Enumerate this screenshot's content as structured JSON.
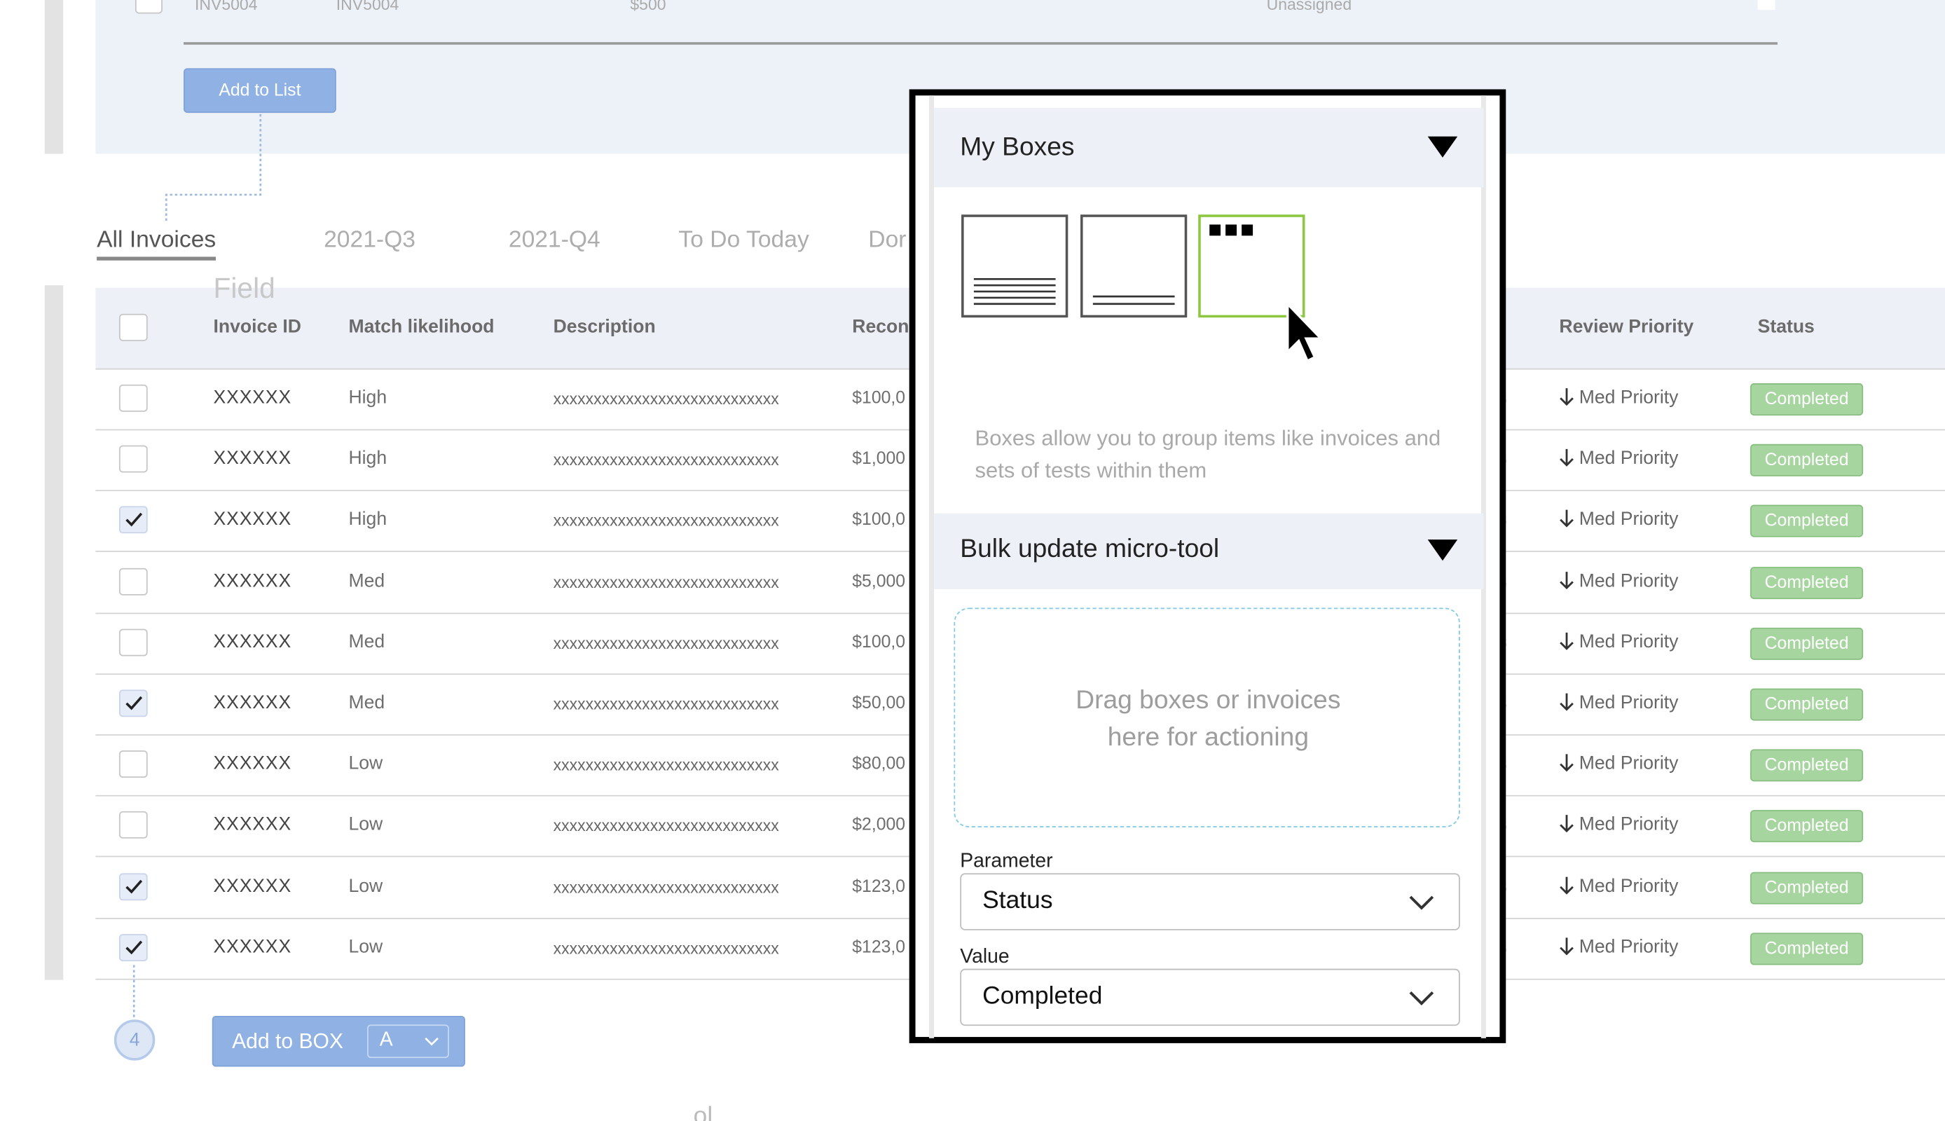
{
  "top_row": {
    "col1": "INV5004",
    "col2": "INV5004",
    "amount": "$500",
    "status": "Unassigned"
  },
  "add_to_list_label": "Add to List",
  "tabs": [
    {
      "label": "All Invoices",
      "active": true
    },
    {
      "label": "2021-Q3"
    },
    {
      "label": "2021-Q4"
    },
    {
      "label": "To Do Today"
    },
    {
      "label": "Dor"
    }
  ],
  "field_label": "Field",
  "columns": [
    "Invoice ID",
    "Match likelihood",
    "Description",
    "Recon",
    "Review Priority",
    "Status"
  ],
  "rows": [
    {
      "checked": false,
      "id": "XXXXXX",
      "match": "High",
      "desc": "xxxxxxxxxxxxxxxxxxxxxxxxxxxx",
      "amount": "$100,0",
      "priority": "Med Priority",
      "status": "Completed"
    },
    {
      "checked": false,
      "id": "XXXXXX",
      "match": "High",
      "desc": "xxxxxxxxxxxxxxxxxxxxxxxxxxxx",
      "amount": "$1,000",
      "priority": "Med Priority",
      "status": "Completed"
    },
    {
      "checked": true,
      "id": "XXXXXX",
      "match": "High",
      "desc": "xxxxxxxxxxxxxxxxxxxxxxxxxxxx",
      "amount": "$100,0",
      "priority": "Med Priority",
      "status": "Completed"
    },
    {
      "checked": false,
      "id": "XXXXXX",
      "match": "Med",
      "desc": "xxxxxxxxxxxxxxxxxxxxxxxxxxxx",
      "amount": "$5,000",
      "priority": "Med Priority",
      "status": "Completed"
    },
    {
      "checked": false,
      "id": "XXXXXX",
      "match": "Med",
      "desc": "xxxxxxxxxxxxxxxxxxxxxxxxxxxx",
      "amount": "$100,0",
      "priority": "Med Priority",
      "status": "Completed"
    },
    {
      "checked": true,
      "id": "XXXXXX",
      "match": "Med",
      "desc": "xxxxxxxxxxxxxxxxxxxxxxxxxxxx",
      "amount": "$50,00",
      "priority": "Med Priority",
      "status": "Completed"
    },
    {
      "checked": false,
      "id": "XXXXXX",
      "match": "Low",
      "desc": "xxxxxxxxxxxxxxxxxxxxxxxxxxxx",
      "amount": "$80,00",
      "priority": "Med Priority",
      "status": "Completed"
    },
    {
      "checked": false,
      "id": "XXXXXX",
      "match": "Low",
      "desc": "xxxxxxxxxxxxxxxxxxxxxxxxxxxx",
      "amount": "$2,000",
      "priority": "Med Priority",
      "status": "Completed"
    },
    {
      "checked": true,
      "id": "XXXXXX",
      "match": "Low",
      "desc": "xxxxxxxxxxxxxxxxxxxxxxxxxxxx",
      "amount": "$123,0",
      "priority": "Med Priority",
      "status": "Completed"
    },
    {
      "checked": true,
      "id": "XXXXXX",
      "match": "Low",
      "desc": "xxxxxxxxxxxxxxxxxxxxxxxxxxxx",
      "amount": "$123,0",
      "priority": "Med Priority",
      "status": "Completed"
    }
  ],
  "selected_count": "4",
  "add_to_box": {
    "label": "Add to BOX",
    "value": "A"
  },
  "panel": {
    "my_boxes_title": "My Boxes",
    "boxes_help": "Boxes allow you to group items like invoices and sets of tests within them",
    "bulk_title": "Bulk update micro-tool",
    "drop_text": "Drag boxes or invoices here for actioning",
    "parameter_label": "Parameter",
    "parameter_value": "Status",
    "value_label": "Value",
    "value_value": "Completed"
  },
  "colors": {
    "accent_blue": "#8fb1e3",
    "status_green": "#a7d5a0",
    "selected_box": "#8dc63f",
    "drop_border": "#7ec9e6"
  },
  "icons": [
    "checkbox-icon",
    "check-icon",
    "arrow-down-icon",
    "triangle-down-icon",
    "chevron-down-icon",
    "mouse-pointer-icon"
  ]
}
